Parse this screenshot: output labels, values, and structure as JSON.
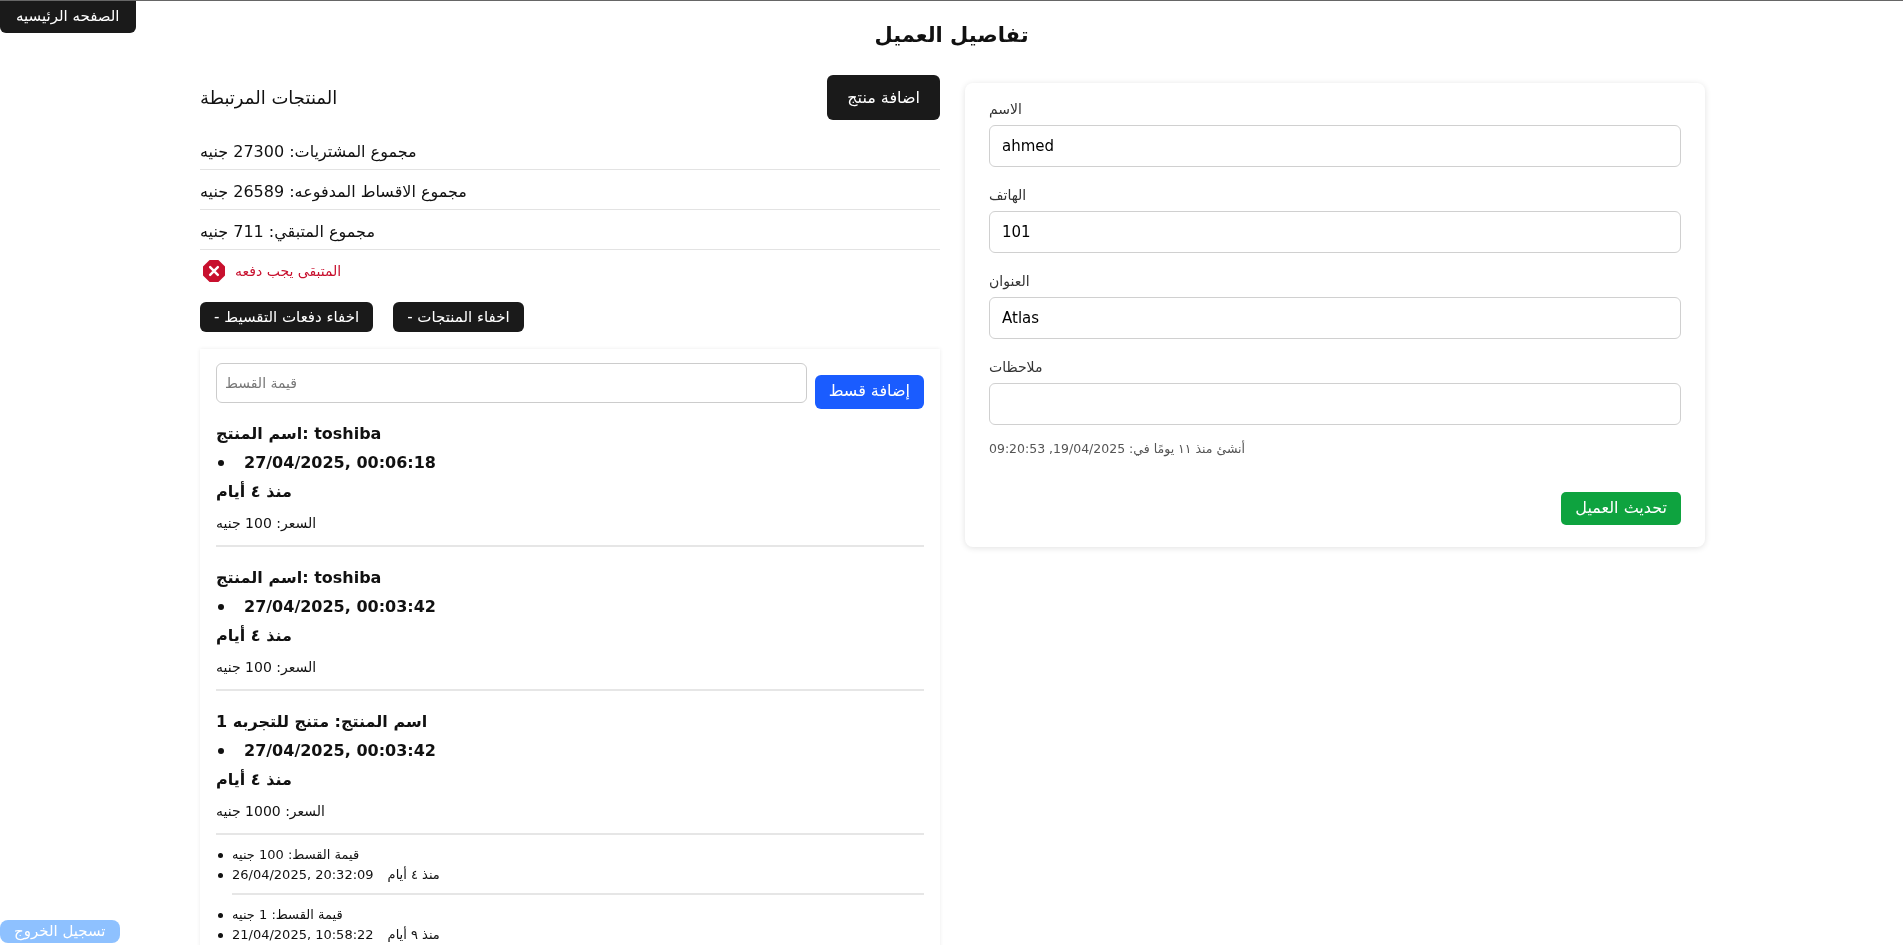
{
  "nav": {
    "home_button": "الصفحه الرئيسيه",
    "logout_button": "تسجيل الخروج"
  },
  "page_title": "تفاصيل العميل",
  "products_section": {
    "title": "المنتجات المرتبطة",
    "add_button": "اضافة منتج",
    "summary": [
      "مجموع المشتريات: 27300 جنيه",
      "مجموع الاقساط المدفوعه: 26589 جنيه",
      "مجموع المتبقي: 711 جنيه"
    ],
    "alert": {
      "kind": "error",
      "text": "المتبقى يجب دفعه"
    },
    "toggles": [
      "اخفاء المنتجات -",
      "اخفاء دفعات التقسيط -"
    ]
  },
  "payments": {
    "amount_field": {
      "placeholder": "قيمة القسط"
    },
    "add_button": "إضافة قسط",
    "products": [
      {
        "name": "اسم المنتج: toshiba",
        "date": "27/04/2025, 00:06:18",
        "ago": "منذ ٤ أيام",
        "price": "السعر: 100 جنيه"
      },
      {
        "name": "اسم المنتج: toshiba",
        "date": "27/04/2025, 00:03:42",
        "ago": "منذ ٤ أيام",
        "price": "السعر: 100 جنيه"
      },
      {
        "name": "اسم المنتج: متنج للتجربه 1",
        "date": "27/04/2025, 00:03:42",
        "ago": "منذ ٤ أيام",
        "price": "السعر: 1000 جنيه",
        "installments": [
          {
            "amount": "قيمة القسط: 100 جنيه",
            "date": "26/04/2025, 20:32:09",
            "ago": "منذ ٤ أيام"
          },
          {
            "amount": "قيمة القسط: 1 جنيه",
            "date": "21/04/2025, 10:58:22",
            "ago": "منذ ٩ أيام"
          }
        ]
      }
    ]
  },
  "customer_form": {
    "fields": [
      {
        "label": "الاسم",
        "value": "ahmed"
      },
      {
        "label": "الهاتف",
        "value": "101"
      },
      {
        "label": "العنوان",
        "value": "Atlas"
      },
      {
        "label": "ملاحظات"
      }
    ],
    "created_note": "أنشئ منذ ١١ يومًا في: 19/04/2025, 09:20:53",
    "submit_button": "تحديث العميل"
  }
}
